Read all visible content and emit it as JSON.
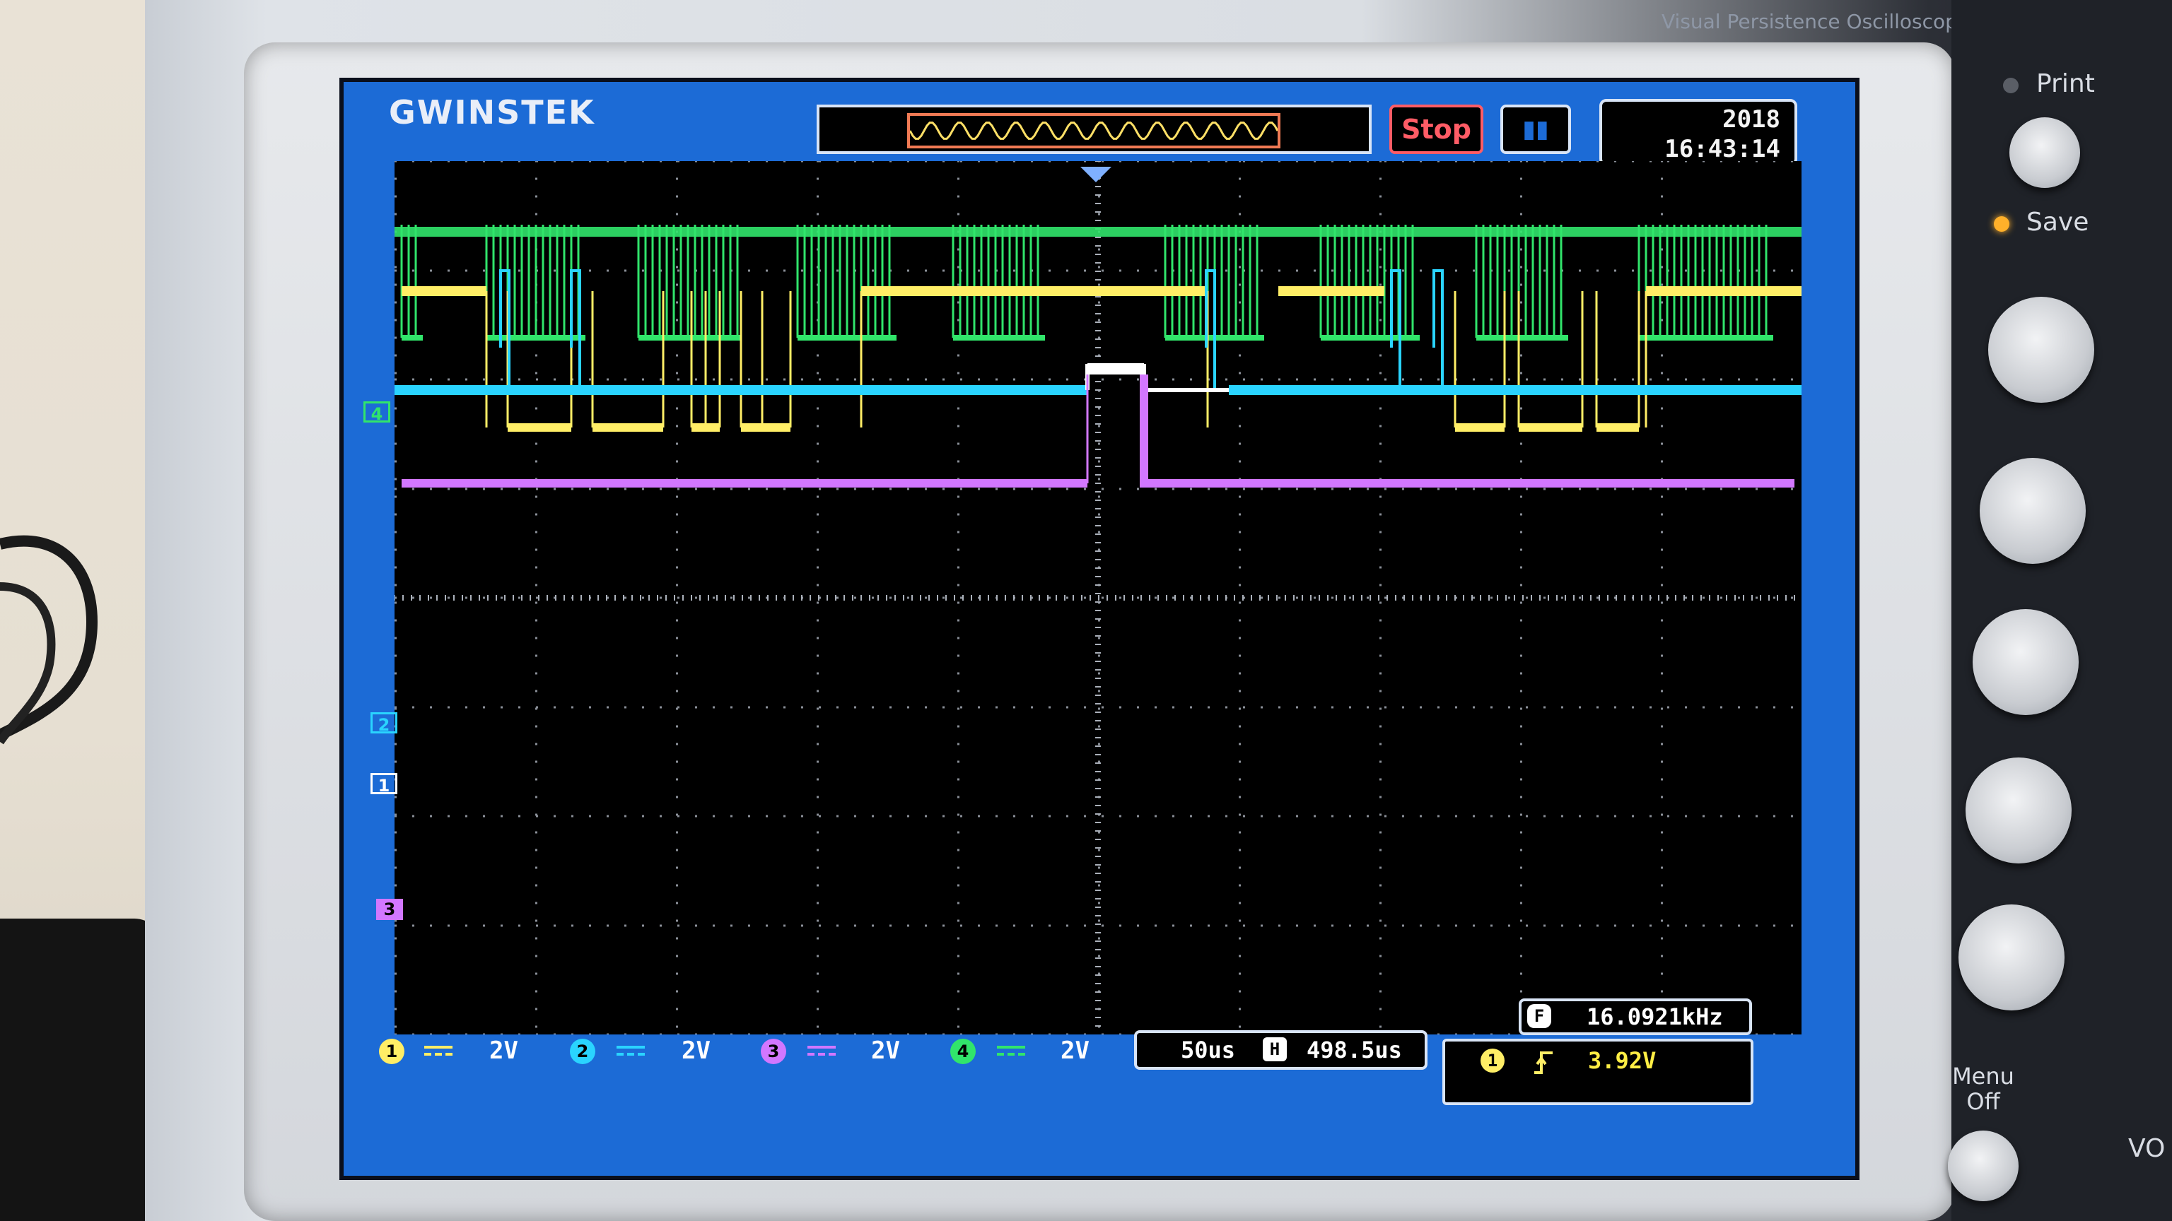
{
  "device": {
    "brand": "GWINSTEK",
    "subtitle": "Visual Persistence Oscilloscope",
    "panel": {
      "print_label": "Print",
      "save_label": "Save",
      "menu_off_label": "Menu\nOff",
      "vo_label": "VO"
    }
  },
  "screen": {
    "run_state": "Stop",
    "clock_line1": "2018",
    "clock_line2": "16:43:14",
    "channels": [
      {
        "id": "1",
        "coupling": "DC",
        "scale": "2V",
        "color": "#2ad4ff"
      },
      {
        "id": "2",
        "coupling": "DC",
        "scale": "2V",
        "color": "#2ad4ff"
      },
      {
        "id": "3",
        "coupling": "DC",
        "scale": "2V",
        "color": "#d277ff"
      },
      {
        "id": "4",
        "coupling": "DC",
        "scale": "2V",
        "color": "#31e56b"
      }
    ],
    "timebase": "50us",
    "h_position_icon": "H",
    "h_position": "498.5us",
    "frequency_label": "F",
    "frequency": "16.0921kHz",
    "trigger_source": "1",
    "trigger_level": "3.92V",
    "colors": {
      "ch_green": "#31e56b",
      "ch_yellow": "#ffee66",
      "ch_cyan": "#2ad4ff",
      "ch_violet": "#d277ff",
      "screen_blue": "#1c6bd6"
    }
  }
}
